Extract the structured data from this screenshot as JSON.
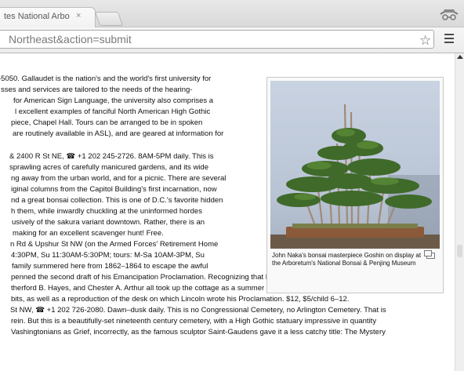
{
  "browser": {
    "tab_title": "tes National Arbo",
    "tab_close": "×",
    "url": "Northeast&action=submit",
    "star": "☆"
  },
  "article": {
    "lines": [
      "-5050. Gallaudet is the nation's and the world's first university for",
      "sses and services are tailored to the needs of the hearing-",
      "for American Sign Language, the university also comprises a",
      "l excellent examples of fanciful North American High Gothic",
      "piece, Chapel Hall. Tours can be arranged to be in spoken",
      "are routinely available in ASL), and are geared at information for",
      "",
      "& 2400 R St NE, ☎ +1 202 245-2726. 8AM-5PM daily. This is",
      "sprawling acres of carefully manicured gardens, and its wide",
      "ng away from the urban world, and for a picnic. There are several",
      "iginal columns from the Capitol Building's first incarnation, now",
      "nd a great bonsai collection. This is one of D.C.'s favorite hidden",
      "h them, while inwardly chuckling at the uninformed hordes",
      "usively of the sakura variant downtown. Rather, there is an",
      "making for an excellent scavenger hunt! Free.",
      "n Rd & Upshur St NW (on the Armed Forces' Retirement Home",
      "4:30PM, Su 11:30AM-5:30PM; tours: M-Sa 10AM-3PM, Su",
      "family summered here from 1862–1864 to escape the awful",
      "penned the second draft of his Emancipation Proclamation. Recognizing that Lincoln's political acumen was rivaled",
      "therford B. Hayes, and Chester A. Arthur all took up the cottage as a summer residence as well. In addition to",
      "bits, as well as a reproduction of the desk on which Lincoln wrote his Proclamation. $12, $5/child 6–12.",
      "St NW, ☎ +1 202 726-2080. Dawn–dusk daily. This is no Congressional Cemetery, no Arlington Cemetery. That is",
      "rein. But this is a beautifully-set nineteenth century cemetery, with a High Gothic statuary impressive in quantity",
      "Vashingtonians as Grief, incorrectly, as the famous sculptor Saint-Gaudens gave it a less catchy title: The Mystery"
    ],
    "figure_caption": "John Naka's bonsai masterpiece Goshin on display at the Arboretum's National Bonsai & Penjing Museum"
  }
}
